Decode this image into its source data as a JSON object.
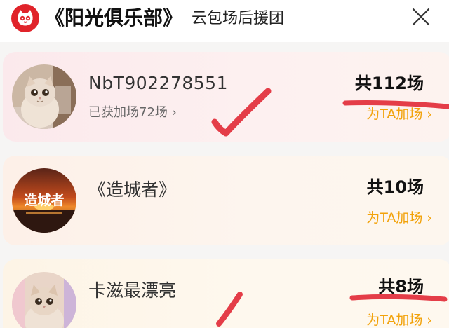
{
  "header": {
    "title": "《阳光俱乐部》",
    "subtitle": "云包场后援团"
  },
  "colors": {
    "brand": "#e0232a",
    "accent": "#f2a20a",
    "annotation": "#e43d48"
  },
  "supporters": [
    {
      "name": "NbT902278551",
      "extra": "已获加场72场",
      "count": "共112场",
      "action": "为TA加场",
      "avatar": "cat-avatar"
    },
    {
      "name": "《造城者》",
      "count": "共10场",
      "action": "为TA加场",
      "avatar_text": "造城者"
    },
    {
      "name": "卡滋最漂亮",
      "count": "共8场",
      "action": "为TA加场",
      "avatar": "cat-avatar"
    }
  ]
}
